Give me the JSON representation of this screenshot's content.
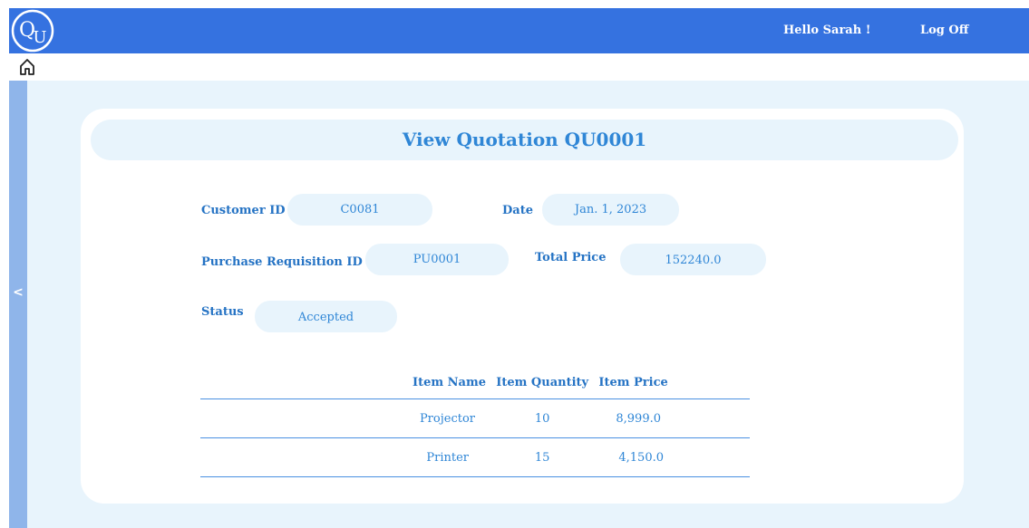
{
  "header": {
    "logo_text": "QU",
    "greeting": "Hello Sarah !",
    "logoff_label": "Log Off"
  },
  "nav": {
    "home_icon": "home-icon",
    "collapse_icon": "chevron-left-icon",
    "collapse_glyph": "<"
  },
  "colors": {
    "header_bg": "#3572e0",
    "accent": "#2f86d6",
    "panel_bg": "#e8f4fc",
    "sidebar_bar": "#8fb5ea"
  },
  "quotation": {
    "title": "View Quotation QU0001",
    "fields": {
      "customer_id_label": "Customer ID",
      "customer_id_value": "C0081",
      "date_label": "Date",
      "date_value": "Jan. 1, 2023",
      "pr_id_label": "Purchase Requisition ID",
      "pr_id_value": "PU0001",
      "total_price_label": "Total Price",
      "total_price_value": "152240.0",
      "status_label": "Status",
      "status_value": "Accepted"
    },
    "items_table": {
      "headers": [
        "Item Name",
        "Item Quantity",
        "Item Price"
      ],
      "rows": [
        [
          "Projector",
          "10",
          "8,999.0"
        ],
        [
          "Printer",
          "15",
          "4,150.0"
        ]
      ]
    }
  }
}
